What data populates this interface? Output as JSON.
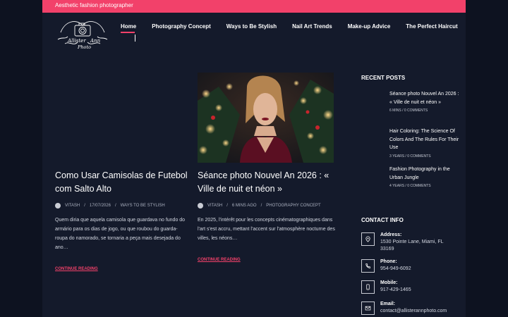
{
  "topbar": {
    "tagline": "Aesthetic fashion photographer"
  },
  "logo": {
    "text_line1": "Allister",
    "text_line2": "Ann",
    "text_line3": "Photo"
  },
  "nav": [
    {
      "label": "Home",
      "active": true
    },
    {
      "label": "Photography Concept"
    },
    {
      "label": "Ways to Be Stylish"
    },
    {
      "label": "Nail Art Trends"
    },
    {
      "label": "Make-up Advice"
    },
    {
      "label": "The Perfect Haircut"
    }
  ],
  "posts": [
    {
      "title": "Como Usar Camisolas de Futebol com Salto Alto",
      "author": "VITASH",
      "date": "17/07/2026",
      "category": "WAYS TO BE STYLISH",
      "excerpt": "Quem diria que aquela camisola que guardava no fundo do armário para os dias de jogo, ou que roubou do guarda-roupa do namorado, se tornaria a peça mais desejada do ano…",
      "more": "CONTINUE READING"
    },
    {
      "title": "Séance photo Nouvel An 2026 : « Ville de nuit et néon »",
      "author": "VITASH",
      "date": "6 MINS AGO",
      "category": "PHOTOGRAPHY CONCEPT",
      "excerpt": "En 2025, l'intérêt pour les concepts cinématographiques dans l'art s'est accru, mettant l'accent sur l'atmosphère nocturne des villes, les néons…",
      "more": "CONTINUE READING"
    }
  ],
  "sidebar": {
    "recent_title": "RECENT POSTS",
    "recent": [
      {
        "title": "Séance photo Nouvel An 2026 : « Ville de nuit et néon »",
        "age": "6 MINS",
        "comments": "0 COMMENTS"
      },
      {
        "title": "Hair Coloring: The Science Of Colors And The Rules For Their Use",
        "age": "3 YEARS",
        "comments": "0 COMMENTS"
      },
      {
        "title": "Fashion Photography in the Urban Jungle",
        "age": "4 YEARS",
        "comments": "0 COMMENTS"
      }
    ],
    "contact_title": "CONTACT INFO",
    "contact": [
      {
        "label": "Address:",
        "value": "1530 Pointe Lane, Miami, FL 33169",
        "icon": "map-pin-icon"
      },
      {
        "label": "Phone:",
        "value": "954-949-6092",
        "icon": "phone-icon"
      },
      {
        "label": "Mobile:",
        "value": "917-429-1465",
        "icon": "mobile-icon"
      },
      {
        "label": "Email:",
        "value": "contact@allisterannphoto.com",
        "icon": "mail-icon"
      }
    ]
  },
  "meta_separator": "/",
  "colors": {
    "accent": "#f2416a",
    "background": "#0d1220",
    "panel": "#141a2b"
  }
}
